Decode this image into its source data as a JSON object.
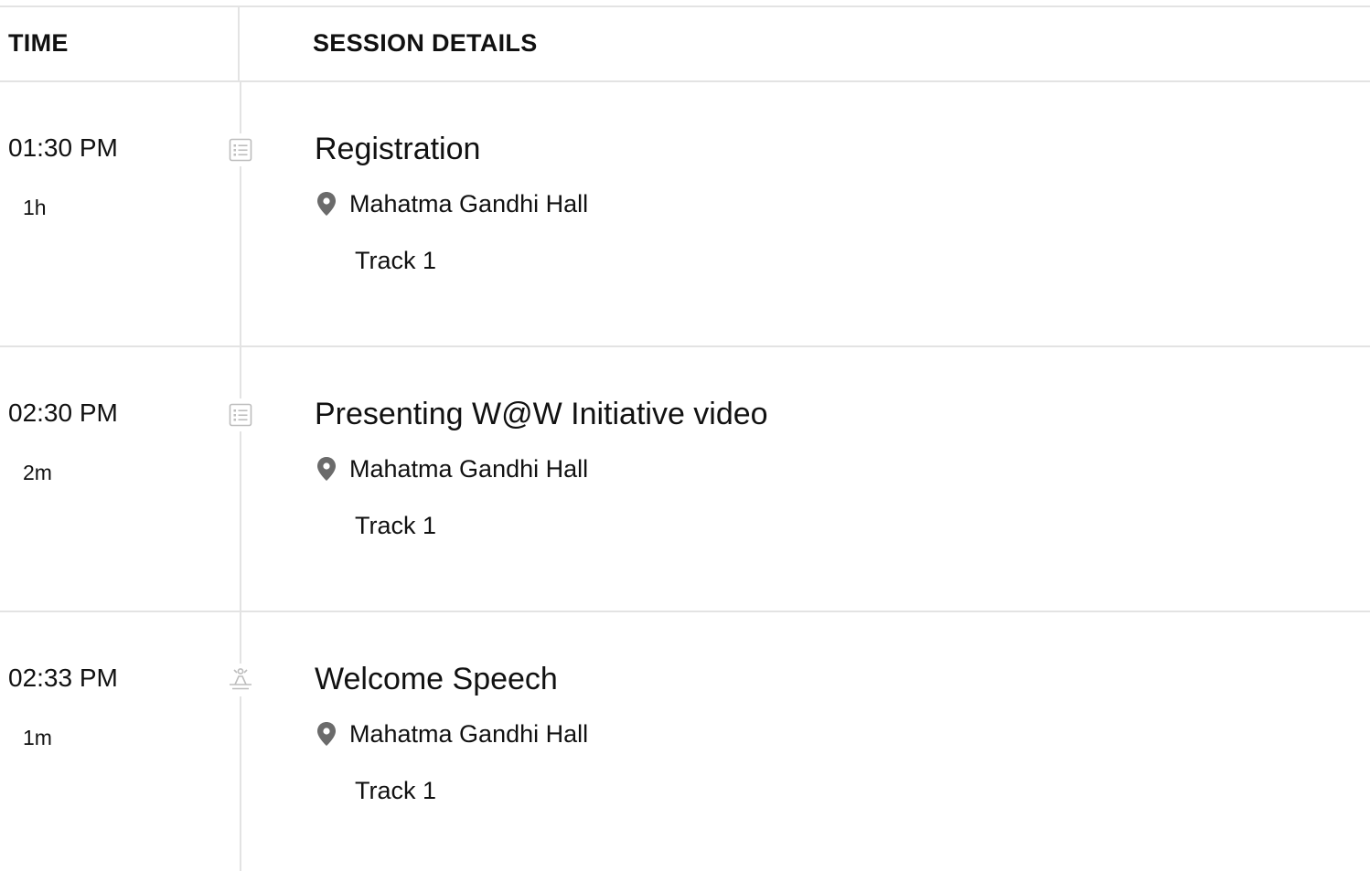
{
  "header": {
    "time_label": "TIME",
    "details_label": "SESSION DETAILS"
  },
  "sessions": [
    {
      "time": "01:30 PM",
      "duration": "1h",
      "type_icon": "list-icon",
      "title": "Registration",
      "location_icon": "location-pin-icon",
      "location": "Mahatma Gandhi Hall",
      "track": "Track 1"
    },
    {
      "time": "02:30 PM",
      "duration": "2m",
      "type_icon": "list-icon",
      "title": "Presenting W@W Initiative video",
      "location_icon": "location-pin-icon",
      "location": "Mahatma Gandhi Hall",
      "track": "Track 1"
    },
    {
      "time": "02:33 PM",
      "duration": "1m",
      "type_icon": "speaker-podium-icon",
      "title": "Welcome Speech",
      "location_icon": "location-pin-icon",
      "location": "Mahatma Gandhi Hall",
      "track": "Track 1"
    }
  ],
  "colors": {
    "divider": "#e3e3e3",
    "icon": "#bdbdbd",
    "pin": "#6b6b6b",
    "text": "#111111"
  }
}
